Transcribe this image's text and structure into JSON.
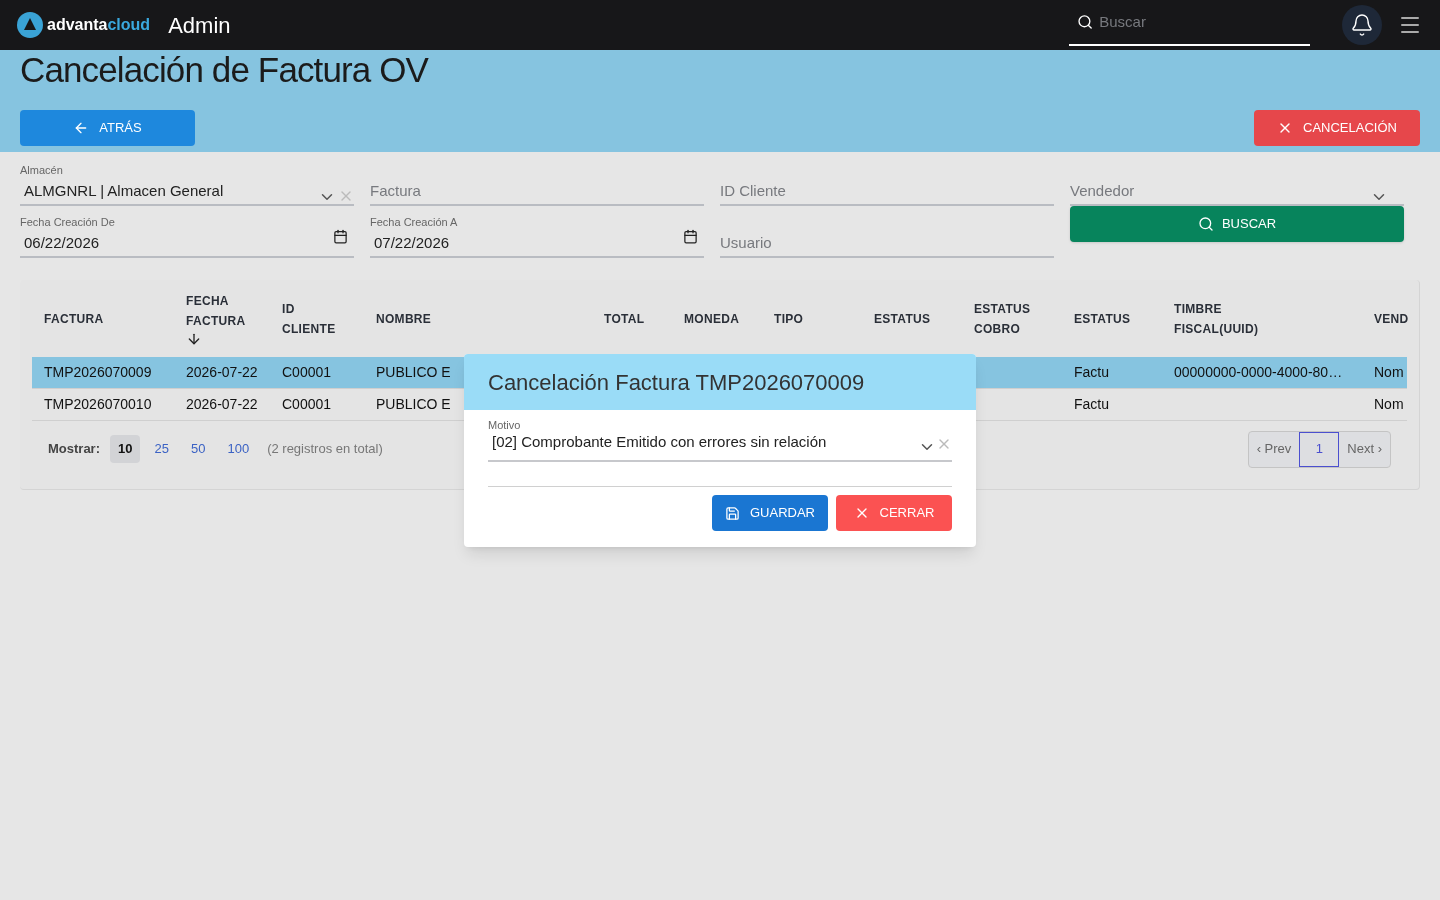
{
  "header": {
    "brand_left": "advanta",
    "brand_right": "cloud",
    "title": "Admin",
    "search": {
      "placeholder": "Buscar"
    }
  },
  "page": {
    "title": "Cancelación de Factura OV",
    "back_button": "ATRÁS",
    "cancel_button": "CANCELACIÓN"
  },
  "filters": [
    {
      "kind": "select",
      "label": "Almacén",
      "value": "ALMGNRL | Almacen General",
      "clearable": true
    },
    {
      "kind": "text",
      "placeholder": "Factura"
    },
    {
      "kind": "text",
      "placeholder": "ID Cliente"
    },
    {
      "kind": "select",
      "placeholder": "Vendedor",
      "clearable": false
    },
    {
      "kind": "date",
      "label": "Fecha Creación De",
      "value": "06/22/2026"
    },
    {
      "kind": "date",
      "label": "Fecha Creación A",
      "value": "07/22/2026"
    },
    {
      "kind": "text",
      "placeholder": "Usuario"
    },
    {
      "kind": "button",
      "label": "BUSCAR"
    }
  ],
  "table": {
    "columns": [
      {
        "label": "FACTURA"
      },
      {
        "label": "FECHA FACTURA",
        "sorted": true
      },
      {
        "label": "ID CLIENTE"
      },
      {
        "label": "NOMBRE"
      },
      {
        "label": "TOTAL"
      },
      {
        "label": "MONEDA"
      },
      {
        "label": "TIPO"
      },
      {
        "label": "ESTATUS"
      },
      {
        "label": "ESTATUS COBRO"
      },
      {
        "label": "ESTATUS"
      },
      {
        "label": "TIMBRE FISCAL(UUID)"
      },
      {
        "label": "VEND"
      }
    ],
    "rows": [
      {
        "selected": true,
        "cells": [
          "TMP2026070009",
          "2026-07-22",
          "C00001",
          "PUBLICO E",
          "",
          "",
          "",
          "",
          "",
          "Factu",
          "00000000-0000-4000-80…",
          "Nom"
        ]
      },
      {
        "selected": false,
        "cells": [
          "TMP2026070010",
          "2026-07-22",
          "C00001",
          "PUBLICO E",
          "",
          "",
          "",
          "",
          "",
          "Factu",
          "",
          "Nom"
        ]
      }
    ],
    "page_size": {
      "label": "Mostrar:",
      "options": [
        {
          "label": "10",
          "selected": true
        },
        {
          "label": "25",
          "selected": false
        },
        {
          "label": "50",
          "selected": false
        },
        {
          "label": "100",
          "selected": false
        }
      ],
      "total": "(2 registros en total)"
    },
    "pagination": {
      "prev": "‹ Prev",
      "pages": [
        {
          "label": "1",
          "selected": true
        }
      ],
      "next": "Next ›"
    }
  },
  "modal": {
    "title": "Cancelación Factura TMP2026070009",
    "field": {
      "label": "Motivo",
      "value": "[02] Comprobante Emitido con errores sin relación"
    },
    "save_button": "GUARDAR",
    "close_button": "CERRAR"
  }
}
